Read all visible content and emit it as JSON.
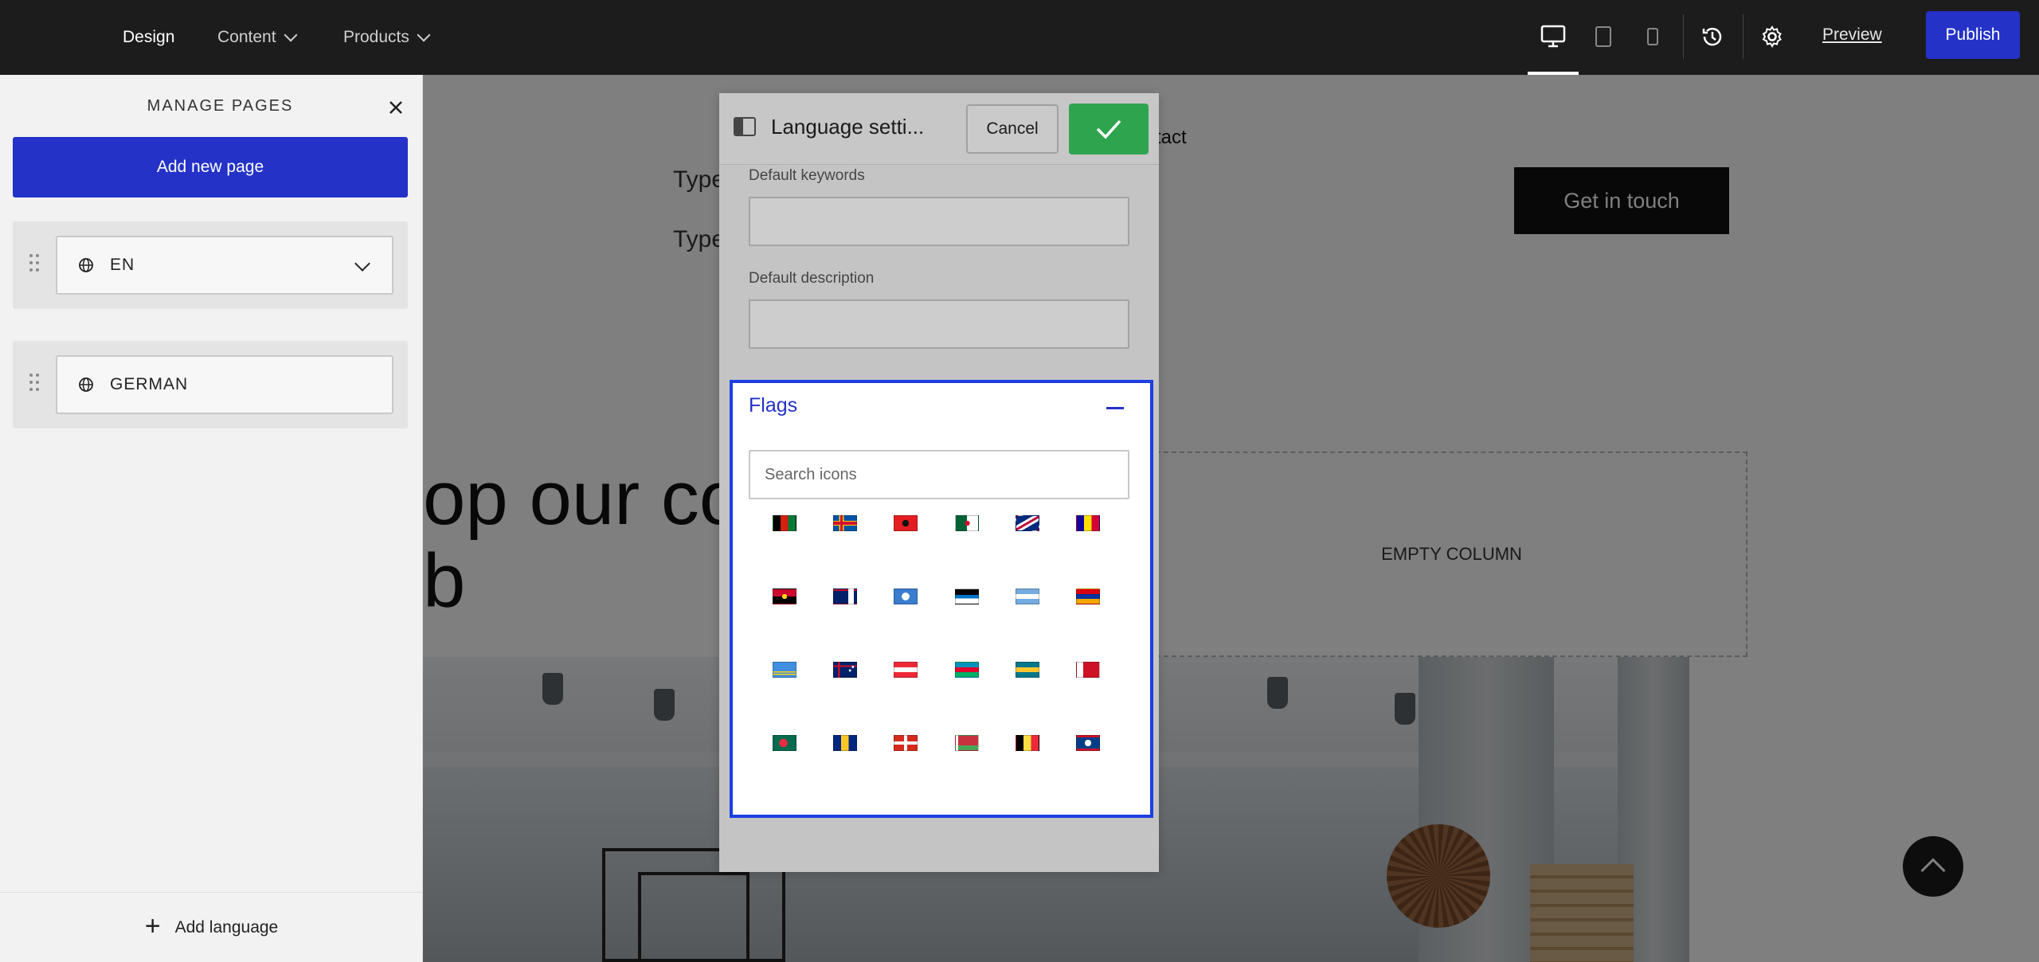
{
  "topbar": {
    "nav": [
      {
        "label": "Design"
      },
      {
        "label": "Content"
      },
      {
        "label": "Products"
      }
    ],
    "preview_label": "Preview",
    "publish_label": "Publish",
    "accent": "#2432c8"
  },
  "canvas": {
    "type_line_1": "Type",
    "type_line_2": "Type",
    "contact_label": "tact",
    "get_in_touch_label": "Get in touch",
    "hero_line_1": "op our co",
    "hero_line_2": "b",
    "empty_column_label": "EMPTY COLUMN"
  },
  "manage_pages": {
    "title": "MANAGE PAGES",
    "add_page_label": "Add new page",
    "languages": [
      {
        "label": "EN",
        "expanded": true
      },
      {
        "label": "GERMAN",
        "expanded": false
      }
    ],
    "add_language_label": "Add language"
  },
  "dialog": {
    "title": "Language setti...",
    "cancel_label": "Cancel",
    "default_keywords_label": "Default keywords",
    "default_description_label": "Default description",
    "flags": {
      "title": "Flags",
      "search_placeholder": "Search icons",
      "icons": [
        "flag-afghanistan-icon",
        "flag-aland-islands-icon",
        "flag-albania-icon",
        "flag-algeria-icon",
        "flag-american-samoa-icon",
        "flag-andorra-icon",
        "flag-angola-icon",
        "flag-anguilla-icon",
        "flag-antarctica-icon",
        "flag-antigua-and-barbuda-icon",
        "flag-argentina-icon",
        "flag-armenia-icon",
        "flag-aruba-icon",
        "flag-australia-icon",
        "flag-austria-icon",
        "flag-azerbaijan-icon",
        "flag-bahamas-icon",
        "flag-bahrain-icon",
        "flag-bangladesh-icon",
        "flag-barbados-icon",
        "flag-basque-country-icon",
        "flag-belarus-icon",
        "flag-belgium-icon",
        "flag-belize-icon"
      ]
    },
    "confirm_color": "#2ea44f"
  }
}
